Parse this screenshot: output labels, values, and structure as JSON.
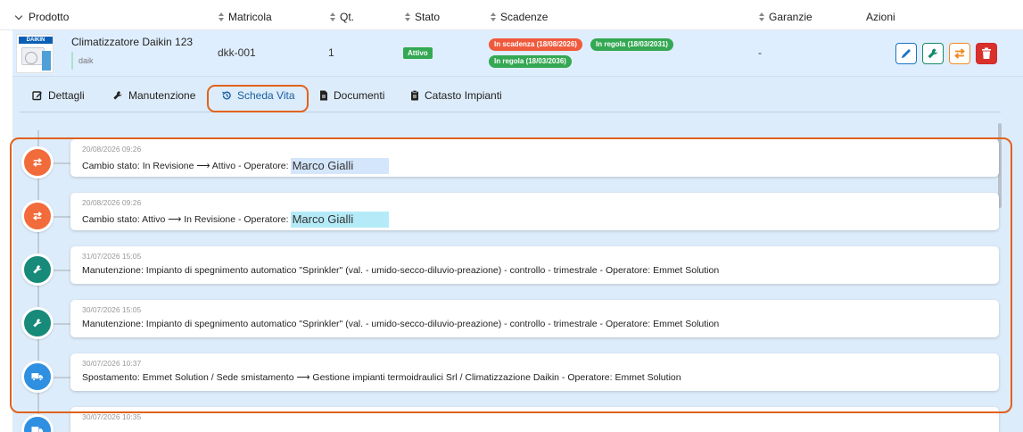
{
  "columns": {
    "prodotto": "Prodotto",
    "matricola": "Matricola",
    "qt": "Qt.",
    "stato": "Stato",
    "scadenze": "Scadenze",
    "garanzie": "Garanzie",
    "azioni": "Azioni"
  },
  "product": {
    "name": "Climatizzatore Daikin 123",
    "tag": "daik",
    "thumb_brand": "DAIKIN",
    "matricola": "dkk-001",
    "qty": "1",
    "stato": "Attivo",
    "scadenze": [
      {
        "label": "In scadenza (18/08/2026)",
        "color": "#f05a3c"
      },
      {
        "label": "In regola (18/03/2031)",
        "color": "#34a853"
      },
      {
        "label": "In regola (18/03/2036)",
        "color": "#34a853"
      }
    ],
    "garanzie": "-",
    "actions": [
      "edit",
      "maintenance",
      "transfer",
      "delete"
    ]
  },
  "tabs": [
    {
      "label": "Dettagli",
      "icon": "edit-icon"
    },
    {
      "label": "Manutenzione",
      "icon": "wrench-icon"
    },
    {
      "label": "Scheda Vita",
      "icon": "history-icon",
      "active": true
    },
    {
      "label": "Documenti",
      "icon": "document-icon"
    },
    {
      "label": "Catasto Impianti",
      "icon": "clipboard-icon"
    }
  ],
  "timeline": [
    {
      "timestamp": "20/08/2026 09:26",
      "text": "Cambio stato: In Revisione ⟶ Attivo - Operatore:",
      "operator": "Marco Gialli",
      "icon": "transfer-icon",
      "color": "#f26b3a"
    },
    {
      "timestamp": "20/08/2026 09:26",
      "text": "Cambio stato: Attivo ⟶ In Revisione - Operatore:",
      "operator": "Marco Gialli",
      "icon": "transfer-icon",
      "color": "#f26b3a"
    },
    {
      "timestamp": "31/07/2026 15:05",
      "text": "Manutenzione: Impianto di spegnimento automatico \"Sprinkler\" (val. - umido-secco-diluvio-preazione) - controllo - trimestrale - Operatore: Emmet Solution",
      "operator": "",
      "icon": "wrench-icon",
      "color": "#178a7a"
    },
    {
      "timestamp": "30/07/2026 15:05",
      "text": "Manutenzione: Impianto di spegnimento automatico \"Sprinkler\" (val. - umido-secco-diluvio-preazione) - controllo - trimestrale - Operatore: Emmet Solution",
      "operator": "",
      "icon": "wrench-icon",
      "color": "#178a7a"
    },
    {
      "timestamp": "30/07/2026 10:37",
      "text": "Spostamento: Emmet Solution / Sede smistamento ⟶ Gestione impianti termoidraulici Srl / Climatizzazione Daikin - Operatore: Emmet Solution",
      "operator": "",
      "icon": "truck-icon",
      "color": "#2f8fe0"
    },
    {
      "timestamp": "30/07/2026 10:35",
      "text": "",
      "operator": "",
      "icon": "truck-icon",
      "color": "#2f8fe0"
    }
  ]
}
